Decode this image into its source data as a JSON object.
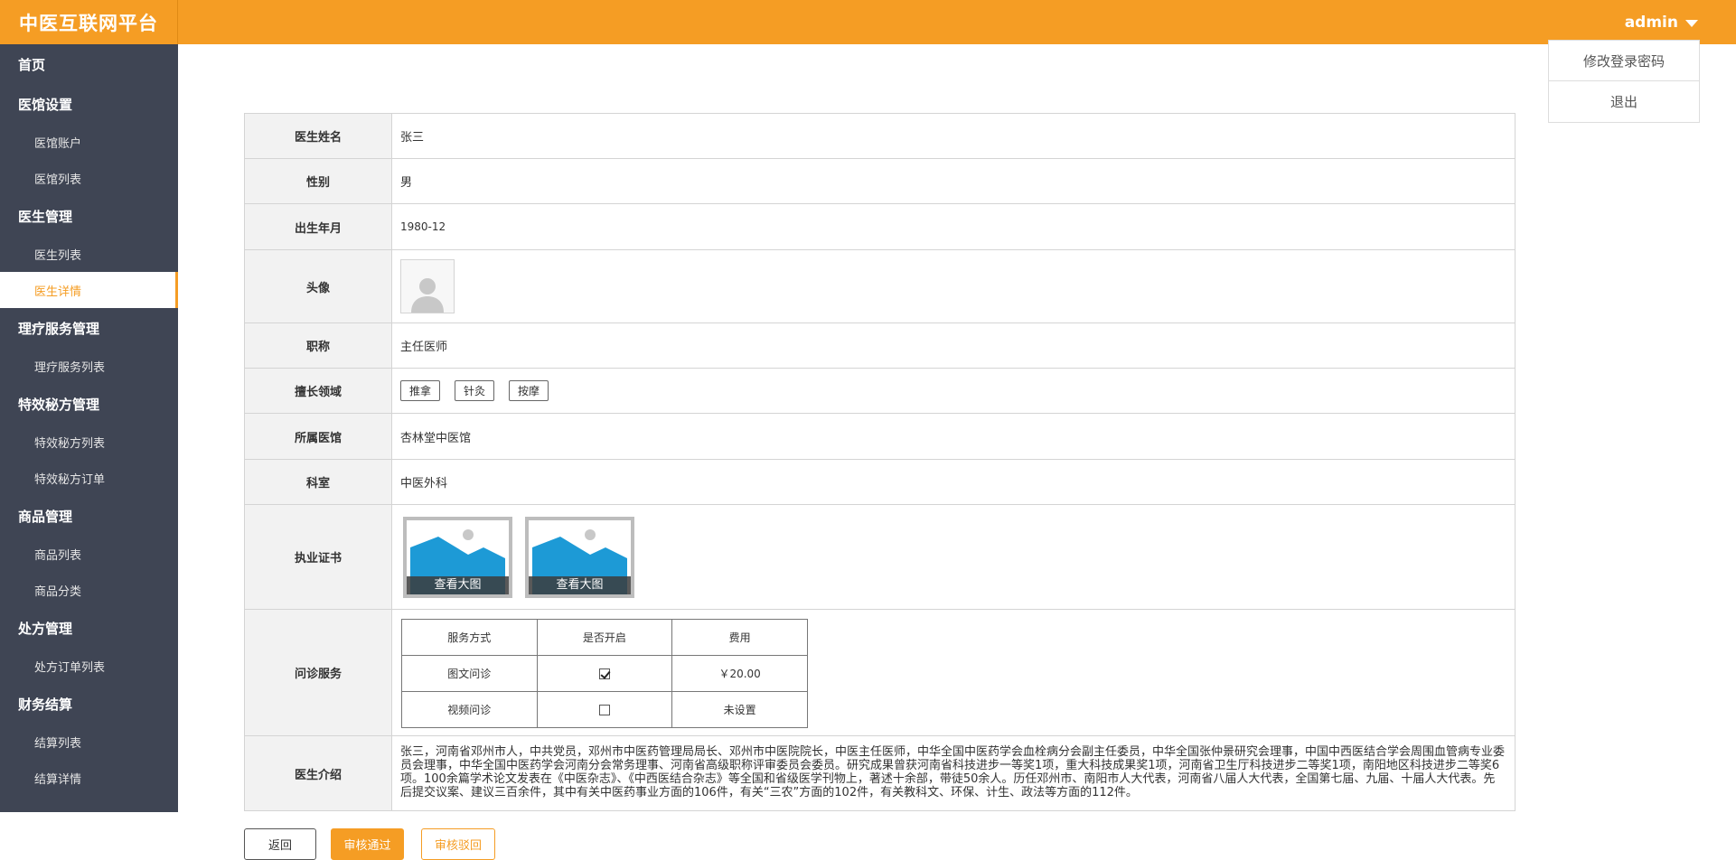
{
  "app": {
    "title": "中医互联网平台",
    "user": "admin",
    "accent_color": "#f59d24",
    "sidebar_color": "#3f4554"
  },
  "user_menu": {
    "items": [
      "修改登录密码",
      "退出"
    ]
  },
  "sidebar": {
    "home": "首页",
    "groups": [
      {
        "label": "医馆设置",
        "items": [
          "医馆账户",
          "医馆列表"
        ]
      },
      {
        "label": "医生管理",
        "items": [
          "医生列表",
          "医生详情"
        ]
      },
      {
        "label": "理疗服务管理",
        "items": [
          "理疗服务列表"
        ]
      },
      {
        "label": "特效秘方管理",
        "items": [
          "特效秘方列表",
          "特效秘方订单"
        ]
      },
      {
        "label": "商品管理",
        "items": [
          "商品列表",
          "商品分类"
        ]
      },
      {
        "label": "处方管理",
        "items": [
          "处方订单列表"
        ]
      },
      {
        "label": "财务结算",
        "items": [
          "结算列表",
          "结算详情"
        ]
      }
    ],
    "active": "医生详情"
  },
  "detail": {
    "name": {
      "label": "医生姓名",
      "value": "张三"
    },
    "gender": {
      "label": "性别",
      "value": "男"
    },
    "birth": {
      "label": "出生年月",
      "value": "1980-12"
    },
    "avatar": {
      "label": "头像",
      "icon": "user-avatar-icon"
    },
    "title": {
      "label": "职称",
      "value": "主任医师"
    },
    "specialty": {
      "label": "擅长领域",
      "tags": [
        "推拿",
        "针灸",
        "按摩"
      ]
    },
    "clinic": {
      "label": "所属医馆",
      "value": "杏林堂中医馆"
    },
    "department": {
      "label": "科室",
      "value": "中医外科"
    },
    "certificates": {
      "label": "执业证书",
      "view_label": "查看大图"
    },
    "consult": {
      "label": "问诊服务",
      "headers": [
        "服务方式",
        "是否开启",
        "费用"
      ],
      "rows": [
        {
          "method": "图文问诊",
          "enabled": true,
          "fee": "￥20.00"
        },
        {
          "method": "视频问诊",
          "enabled": false,
          "fee": "未设置"
        }
      ]
    },
    "intro": {
      "label": "医生介绍",
      "text": "张三，河南省邓州市人，中共党员，邓州市中医药管理局局长、邓州市中医院院长，中医主任医师，中华全国中医药学会血栓病分会副主任委员，中华全国张仲景研究会理事，中国中西医结合学会周围血管病专业委员会理事，中华全国中医药学会河南分会常务理事、河南省高级职称评审委员会委员。研究成果曾获河南省科技进步一等奖1项，重大科技成果奖1项，河南省卫生厅科技进步二等奖1项，南阳地区科技进步二等奖6项。100余篇学术论文发表在《中医杂志》、《中西医结合杂志》等全国和省级医学刊物上，著述十余部，带徒50余人。历任邓州市、南阳市人大代表，河南省八届人大代表，全国第七届、九届、十届人大代表。先后提交议案、建议三百余件，其中有关中医药事业方面的106件，有关“三农”方面的102件，有关教科文、环保、计生、政法等方面的112件。"
    }
  },
  "actions": {
    "back": "返回",
    "approve": "审核通过",
    "reject": "审核驳回"
  }
}
